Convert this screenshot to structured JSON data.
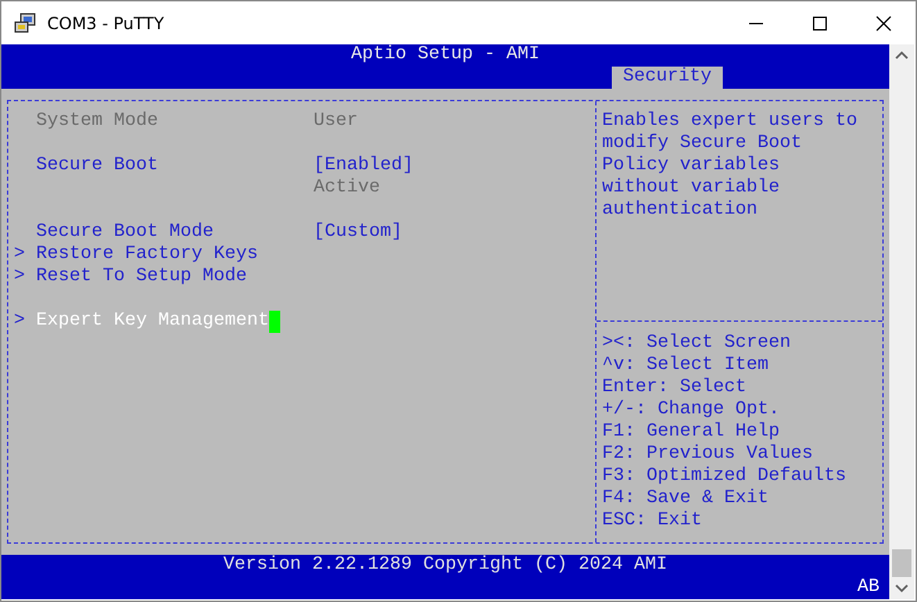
{
  "window": {
    "title": "COM3 - PuTTY"
  },
  "header": {
    "title": "Aptio Setup - AMI",
    "tabs": [
      {
        "label": "Security",
        "selected": true
      }
    ]
  },
  "items": [
    {
      "kind": "info",
      "label": "System Mode",
      "value": "User"
    },
    {
      "kind": "blank"
    },
    {
      "kind": "option",
      "label": "Secure Boot",
      "value": "[Enabled]",
      "selected": false
    },
    {
      "kind": "info",
      "value": "Active"
    },
    {
      "kind": "blank"
    },
    {
      "kind": "option",
      "label": "Secure Boot Mode",
      "value": "[Custom]",
      "selected": false
    },
    {
      "kind": "submenu",
      "marker": ">",
      "label": "Restore Factory Keys",
      "selected": false
    },
    {
      "kind": "submenu",
      "marker": ">",
      "label": "Reset To Setup Mode",
      "selected": false
    },
    {
      "kind": "blank"
    },
    {
      "kind": "submenu",
      "marker": ">",
      "label": "Expert Key Management",
      "selected": true
    }
  ],
  "help": "Enables expert users to modify Secure Boot Policy variables without variable authentication",
  "keys": [
    "><: Select Screen",
    "^v: Select Item",
    "Enter: Select",
    "+/-: Change Opt.",
    "F1: General Help",
    "F2: Previous Values",
    "F3: Optimized Defaults",
    "F4: Save & Exit",
    "ESC: Exit"
  ],
  "footer": {
    "version": "Version 2.22.1289 Copyright (C) 2024 AMI",
    "indicator": "AB"
  }
}
